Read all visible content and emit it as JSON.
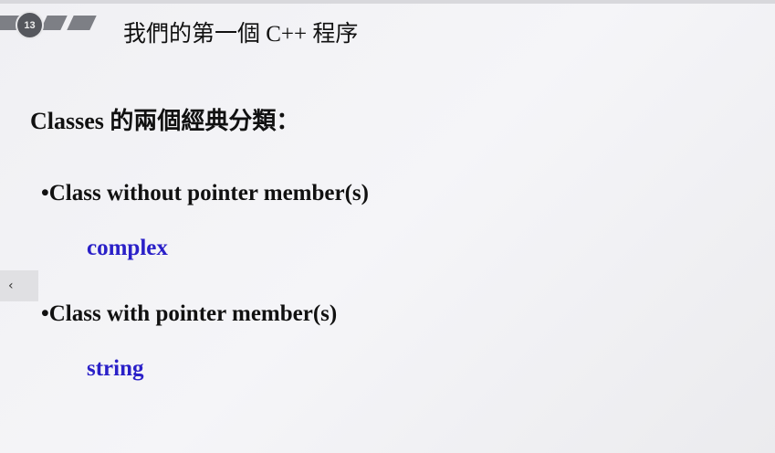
{
  "slide": {
    "number": "13",
    "title": "我們的第一個 C++ 程序",
    "heading": "Classes 的兩個經典分類：",
    "items": [
      {
        "label": "•Class without pointer member(s)",
        "example": "complex"
      },
      {
        "label": "•Class with pointer member(s)",
        "example": "string"
      }
    ]
  },
  "nav": {
    "prev": "‹"
  },
  "colors": {
    "example": "#2a20c8"
  }
}
